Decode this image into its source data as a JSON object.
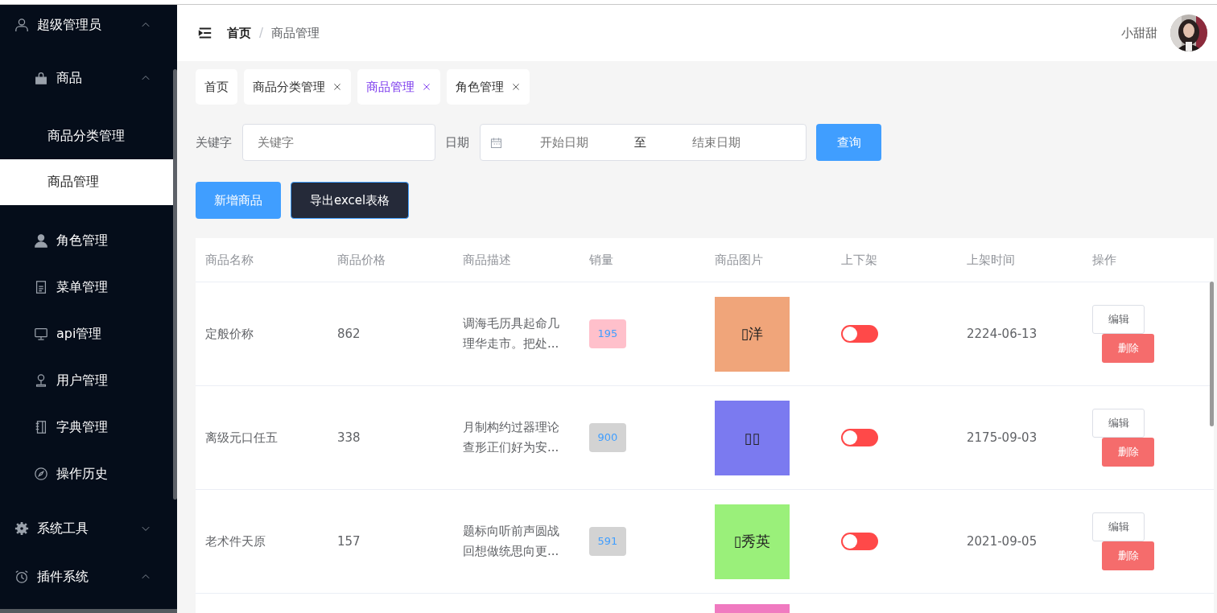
{
  "sidebar": {
    "items": [
      {
        "label": "超级管理员",
        "selected": false,
        "expanded": true,
        "children": [
          {
            "label": "商品",
            "selected": false,
            "expanded": true,
            "children": [
              {
                "label": "商品分类管理",
                "selected": false
              },
              {
                "label": "商品管理",
                "selected": true
              }
            ]
          },
          {
            "label": "角色管理",
            "selected": false
          },
          {
            "label": "菜单管理",
            "selected": false
          },
          {
            "label": "api管理",
            "selected": false
          },
          {
            "label": "用户管理",
            "selected": false
          },
          {
            "label": "字典管理",
            "selected": false
          },
          {
            "label": "操作历史",
            "selected": false
          }
        ]
      },
      {
        "label": "系统工具",
        "selected": false,
        "expanded": false
      },
      {
        "label": "插件系统",
        "selected": false,
        "expanded": true
      }
    ]
  },
  "header": {
    "breadcrumb": [
      "首页",
      "商品管理"
    ],
    "breadcrumb_separator": "/",
    "user_name": "小甜甜"
  },
  "tabs": [
    {
      "label": "首页",
      "closable": false,
      "selected": false
    },
    {
      "label": "商品分类管理",
      "closable": true,
      "selected": false
    },
    {
      "label": "商品管理",
      "closable": true,
      "selected": true
    },
    {
      "label": "角色管理",
      "closable": true,
      "selected": false
    }
  ],
  "filters": {
    "keyword_label": "关键字",
    "keyword_placeholder": "关键字",
    "date_label": "日期",
    "start_placeholder": "开始日期",
    "separator": "至",
    "end_placeholder": "结束日期",
    "search_button": "查询"
  },
  "actions": [
    {
      "label": "新增商品",
      "kind": "primary"
    },
    {
      "label": "导出excel表格",
      "kind": "dark"
    }
  ],
  "table": {
    "columns": [
      "商品名称",
      "商品价格",
      "商品描述",
      "销量",
      "商品图片",
      "上下架",
      "上架时间",
      "操作"
    ],
    "rows": [
      {
        "name": "定般价称",
        "price": "862",
        "description": "调海毛历具起命几理华走市。把处...",
        "sales": {
          "text": "195",
          "color": "#ffc0cb"
        },
        "image": {
          "text": "▯洋",
          "color": "#f0a57a"
        },
        "on": false,
        "time": "2224-06-13",
        "edit": "编辑",
        "delete": "删除"
      },
      {
        "name": "离级元口任五",
        "price": "338",
        "description": "月制构约过器理论查形正们好为安...",
        "sales": {
          "text": "900",
          "color": "#d3d3d3"
        },
        "image": {
          "text": "▯▯",
          "color": "#7b7af0"
        },
        "on": false,
        "time": "2175-09-03",
        "edit": "编辑",
        "delete": "删除"
      },
      {
        "name": "老术件天原",
        "price": "157",
        "description": "题标向听前声圆战回想做统思向更...",
        "sales": {
          "text": "591",
          "color": "#d3d3d3"
        },
        "image": {
          "text": "▯秀英",
          "color": "#9af07a"
        },
        "on": false,
        "time": "2021-09-05",
        "edit": "编辑",
        "delete": "删除"
      },
      {
        "image": {
          "color": "#f07ac0"
        }
      }
    ]
  }
}
